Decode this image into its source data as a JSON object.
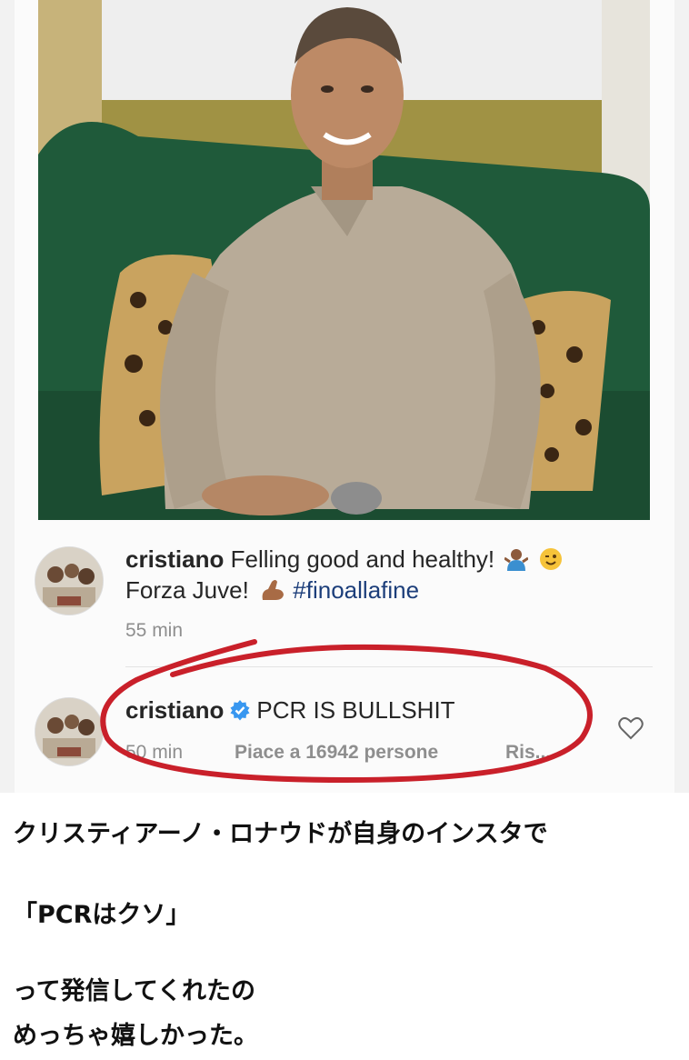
{
  "post": {
    "username": "cristiano",
    "caption_line1": "Felling good and healthy!",
    "caption_line2": "Forza Juve!",
    "hashtag": "#finoallafine",
    "time": "55 min"
  },
  "comment": {
    "username": "cristiano",
    "text": "PCR IS BULLSHIT",
    "time": "50 min",
    "likes": "Piace a 16942 persone",
    "reply": "Ris..."
  },
  "icons": {
    "verified": "verified-badge-icon",
    "shrug": "shrug-emoji-icon",
    "wink": "wink-emoji-icon",
    "muscle": "flexed-biceps-emoji-icon",
    "heart": "heart-icon"
  },
  "colors": {
    "annotation_circle": "#c9202a",
    "verified": "#3897f0",
    "hashtag": "#1c3e7a"
  },
  "caption_text": {
    "line1": "クリスティアーノ・ロナウドが自身のインスタで",
    "line2": "「PCRはクソ」",
    "line3": "って発信してくれたの",
    "line4": "めっちゃ嬉しかった。"
  }
}
